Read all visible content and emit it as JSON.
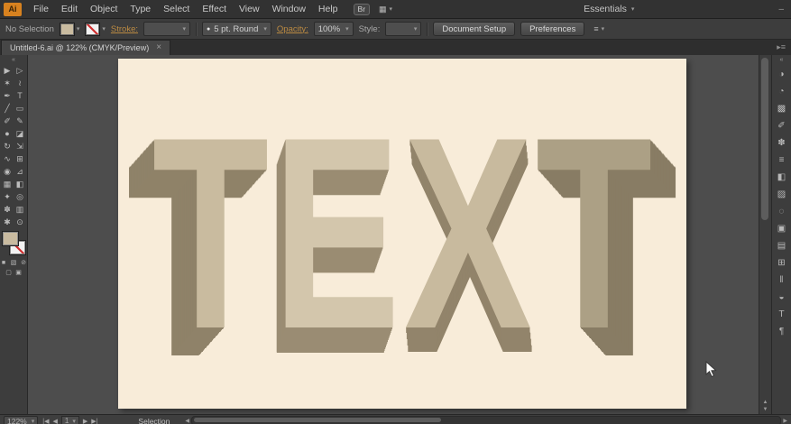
{
  "window": {
    "minimize": "–"
  },
  "colors": {
    "chrome": "#3d3d3d",
    "canvas_bg": "#4d4d4d",
    "artboard_bg": "#f8ecd9",
    "letter_face": "#c9bb9f",
    "letter_side": "#8f8269",
    "fill_swatch": "#c9bba0",
    "logo_orange": "#d8821f"
  },
  "menubar": {
    "logo": "Ai",
    "items": [
      "File",
      "Edit",
      "Object",
      "Type",
      "Select",
      "Effect",
      "View",
      "Window",
      "Help"
    ],
    "bridge_label": "Br",
    "switcher_icon": "▦",
    "workspace": "Essentials",
    "arrow": "▾"
  },
  "controlbar": {
    "no_selection": "No Selection",
    "stroke_label": "Stroke:",
    "brush_dot": "●",
    "brush_value": "5 pt. Round",
    "opacity_label": "Opacity:",
    "opacity_value": "100%",
    "style_label": "Style:",
    "document_setup": "Document Setup",
    "preferences": "Preferences",
    "menu_icon": "≡",
    "arrow": "▾"
  },
  "tabbar": {
    "title": "Untitled-6.ai @ 122% (CMYK/Preview)",
    "close": "×",
    "right_icon": "▸≡"
  },
  "toolbar": {
    "collapse": "«",
    "tools": [
      {
        "name": "selection",
        "glyph": "▶"
      },
      {
        "name": "direct-selection",
        "glyph": "▷"
      },
      {
        "name": "magic-wand",
        "glyph": "✶"
      },
      {
        "name": "lasso",
        "glyph": "≀"
      },
      {
        "name": "pen",
        "glyph": "✒"
      },
      {
        "name": "type",
        "glyph": "T"
      },
      {
        "name": "line-segment",
        "glyph": "╱"
      },
      {
        "name": "rectangle",
        "glyph": "▭"
      },
      {
        "name": "paintbrush",
        "glyph": "✐"
      },
      {
        "name": "pencil",
        "glyph": "✎"
      },
      {
        "name": "blob-brush",
        "glyph": "●"
      },
      {
        "name": "eraser",
        "glyph": "◪"
      },
      {
        "name": "rotate",
        "glyph": "↻"
      },
      {
        "name": "scale",
        "glyph": "⇲"
      },
      {
        "name": "width",
        "glyph": "∿"
      },
      {
        "name": "free-transform",
        "glyph": "⊞"
      },
      {
        "name": "shape-builder",
        "glyph": "◉"
      },
      {
        "name": "perspective-grid",
        "glyph": "⊿"
      },
      {
        "name": "mesh",
        "glyph": "▦"
      },
      {
        "name": "gradient",
        "glyph": "◧"
      },
      {
        "name": "eyedropper",
        "glyph": "✦"
      },
      {
        "name": "blend",
        "glyph": "◎"
      },
      {
        "name": "symbol-sprayer",
        "glyph": "✽"
      },
      {
        "name": "column-graph",
        "glyph": "▥"
      },
      {
        "name": "hand",
        "glyph": "✱"
      },
      {
        "name": "zoom",
        "glyph": "⊙"
      }
    ],
    "bottom_row1": [
      "■",
      "▧",
      "⊘"
    ],
    "bottom_row2": [
      "▢",
      "▣"
    ]
  },
  "panelstrip": {
    "collapse": "«",
    "icons": [
      {
        "name": "color",
        "glyph": "◑"
      },
      {
        "name": "color-guide",
        "glyph": "◔"
      },
      {
        "name": "swatches",
        "glyph": "▩"
      },
      {
        "name": "brushes",
        "glyph": "✐"
      },
      {
        "name": "symbols",
        "glyph": "✽"
      },
      {
        "name": "stroke",
        "glyph": "≡"
      },
      {
        "name": "gradient",
        "glyph": "◧"
      },
      {
        "name": "transparency",
        "glyph": "▨"
      },
      {
        "name": "appearance",
        "glyph": "◌"
      },
      {
        "name": "graphic-styles",
        "glyph": "▣"
      },
      {
        "name": "layers",
        "glyph": "▤"
      },
      {
        "name": "artboards",
        "glyph": "⊞"
      },
      {
        "name": "align",
        "glyph": "‖"
      },
      {
        "name": "pathfinder",
        "glyph": "◒"
      },
      {
        "name": "character",
        "glyph": "T"
      },
      {
        "name": "paragraph",
        "glyph": "¶"
      }
    ]
  },
  "artboard": {
    "letters": [
      "T",
      "E",
      "X",
      "T"
    ]
  },
  "scrollbar": {
    "up": "▲",
    "down": "▼"
  },
  "statusbar": {
    "zoom": "122%",
    "arrow": "▾",
    "nav_first": "|◀",
    "nav_prev": "◀",
    "page": "1",
    "nav_next": "▶",
    "nav_last": "▶|",
    "status": "Selection",
    "scroll_left": "◀",
    "scroll_right": "▶"
  }
}
